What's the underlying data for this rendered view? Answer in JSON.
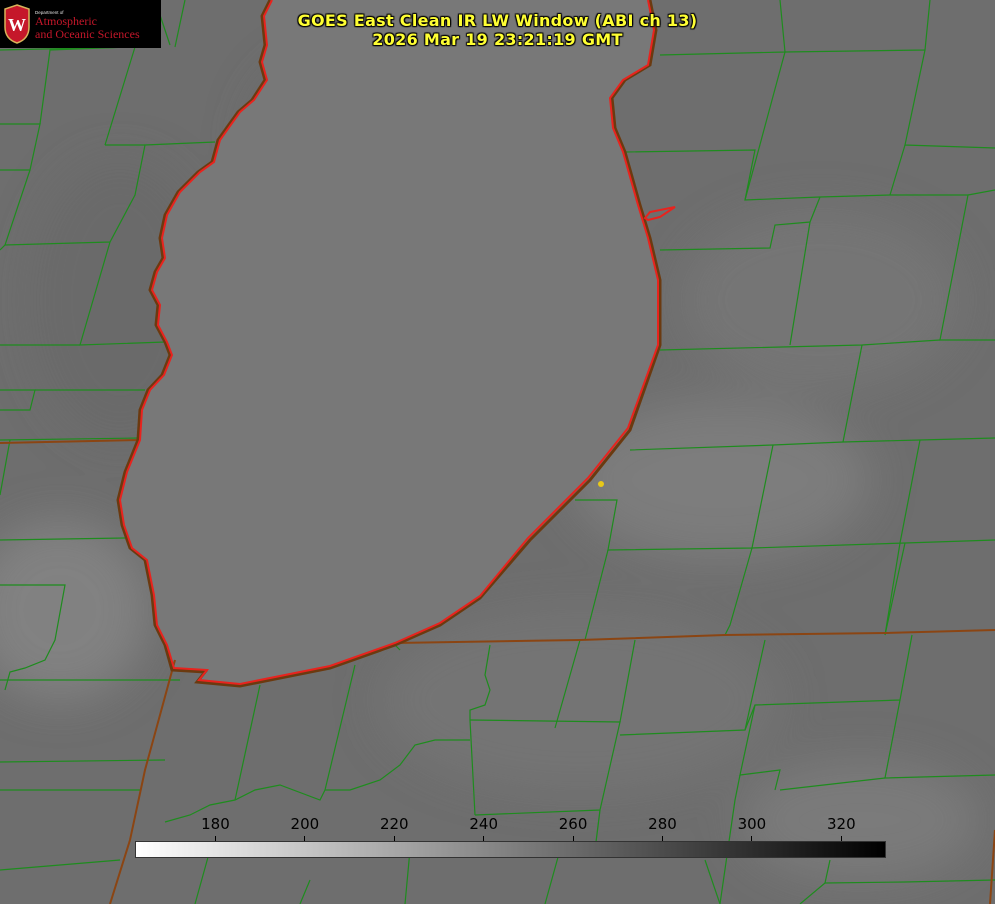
{
  "header": {
    "title_line1": "GOES East Clean IR LW Window (ABI ch 13)",
    "title_line2": "2026 Mar 19 23:21:19 GMT"
  },
  "logo": {
    "department": "Department of",
    "line1": "Atmospheric",
    "line2": "and Oceanic Sciences",
    "seal_letter": "W"
  },
  "colorbar": {
    "ticks": [
      "180",
      "200",
      "220",
      "240",
      "260",
      "280",
      "300",
      "320"
    ],
    "min": 162,
    "max": 330,
    "gradient": [
      "#ffffff",
      "#000000"
    ]
  },
  "colors": {
    "county_lines": "#1e8c1e",
    "coastline": "#e8231e",
    "state_border": "#8b4513",
    "title": "#ffff33",
    "station": "#e8c818"
  }
}
